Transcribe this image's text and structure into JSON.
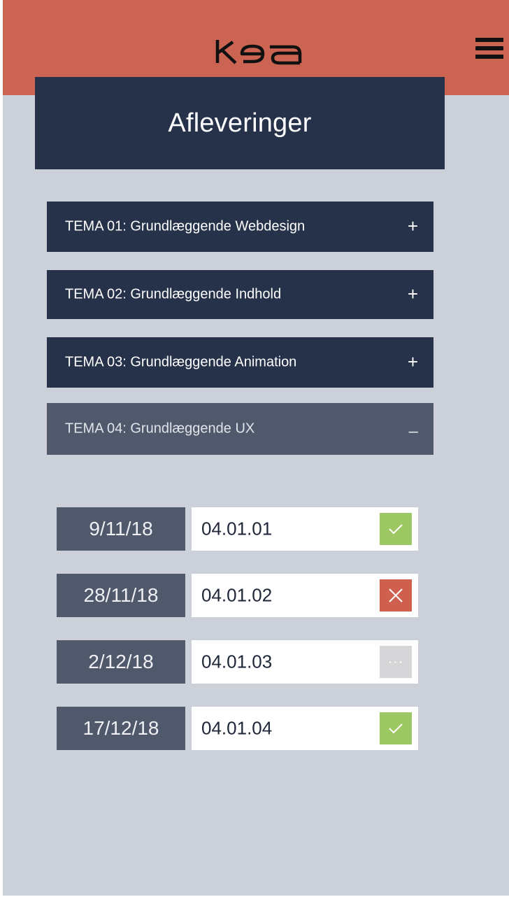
{
  "header": {
    "logo_text": "kea",
    "menu_icon": "hamburger-menu-icon",
    "background_color": "#cc6454"
  },
  "page": {
    "title": "Afleveringer"
  },
  "temas": [
    {
      "label": "TEMA 01: Grundlæggende Webdesign",
      "toggle": "+",
      "expanded": false
    },
    {
      "label": "TEMA 02: Grundlæggende Indhold",
      "toggle": "+",
      "expanded": false
    },
    {
      "label": "TEMA 03: Grundlæggende Animation",
      "toggle": "+",
      "expanded": false
    },
    {
      "label": "TEMA 04: Grundlæggende UX",
      "toggle": "–",
      "expanded": true
    }
  ],
  "assignments": [
    {
      "date": "9/11/18",
      "code": "04.01.01",
      "status": "approved",
      "status_icon": "check-icon",
      "status_color": "#9cc763"
    },
    {
      "date": "28/11/18",
      "code": "04.01.02",
      "status": "rejected",
      "status_icon": "close-icon",
      "status_color": "#d0604e"
    },
    {
      "date": "2/12/18",
      "code": "04.01.03",
      "status": "pending",
      "status_icon": "ellipsis-icon",
      "status_text": "···",
      "status_color": "#d6d6d8"
    },
    {
      "date": "17/12/18",
      "code": "04.01.04",
      "status": "approved",
      "status_icon": "check-icon",
      "status_color": "#9cc763"
    }
  ],
  "colors": {
    "navy": "#26324a",
    "slate": "#4f596b",
    "background": "#ccd0d8"
  }
}
